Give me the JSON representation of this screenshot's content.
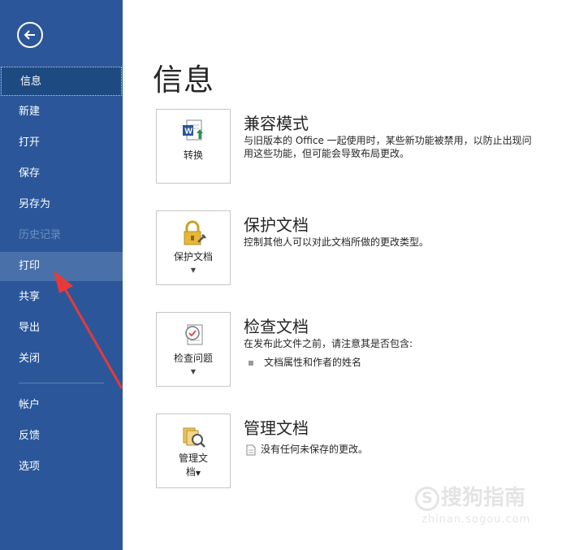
{
  "sidebar": {
    "items": [
      {
        "label": "信息"
      },
      {
        "label": "新建"
      },
      {
        "label": "打开"
      },
      {
        "label": "保存"
      },
      {
        "label": "另存为"
      },
      {
        "label": "历史记录"
      },
      {
        "label": "打印"
      },
      {
        "label": "共享"
      },
      {
        "label": "导出"
      },
      {
        "label": "关闭"
      },
      {
        "label": "帐户"
      },
      {
        "label": "反馈"
      },
      {
        "label": "选项"
      }
    ]
  },
  "main": {
    "title": "信息",
    "sections": [
      {
        "tile_label": "转换",
        "title": "兼容模式",
        "desc_line1": "与旧版本的 Office 一起使用时，某些新功能被禁用，以防止出现问",
        "desc_line2": "用这些功能，但可能会导致布局更改。"
      },
      {
        "tile_label": "保护文档",
        "title": "保护文档",
        "desc_line1": "控制其他人可以对此文档所做的更改类型。"
      },
      {
        "tile_label": "检查问题",
        "title": "检查文档",
        "desc_line1": "在发布此文件之前，请注意其是否包含:",
        "bullet": "文档属性和作者的姓名"
      },
      {
        "tile_label_line1": "管理文",
        "tile_label_line2": "档",
        "title": "管理文档",
        "desc_line1": "没有任何未保存的更改。"
      }
    ]
  },
  "watermark": {
    "logo_char": "S",
    "text": "搜狗指南",
    "url": "zhinan.sogou.com"
  },
  "colors": {
    "sidebar": "#2b579a",
    "active_item": "#1e4a82",
    "hover_item": "#4a70aa",
    "annotation_arrow": "#e8393a"
  }
}
